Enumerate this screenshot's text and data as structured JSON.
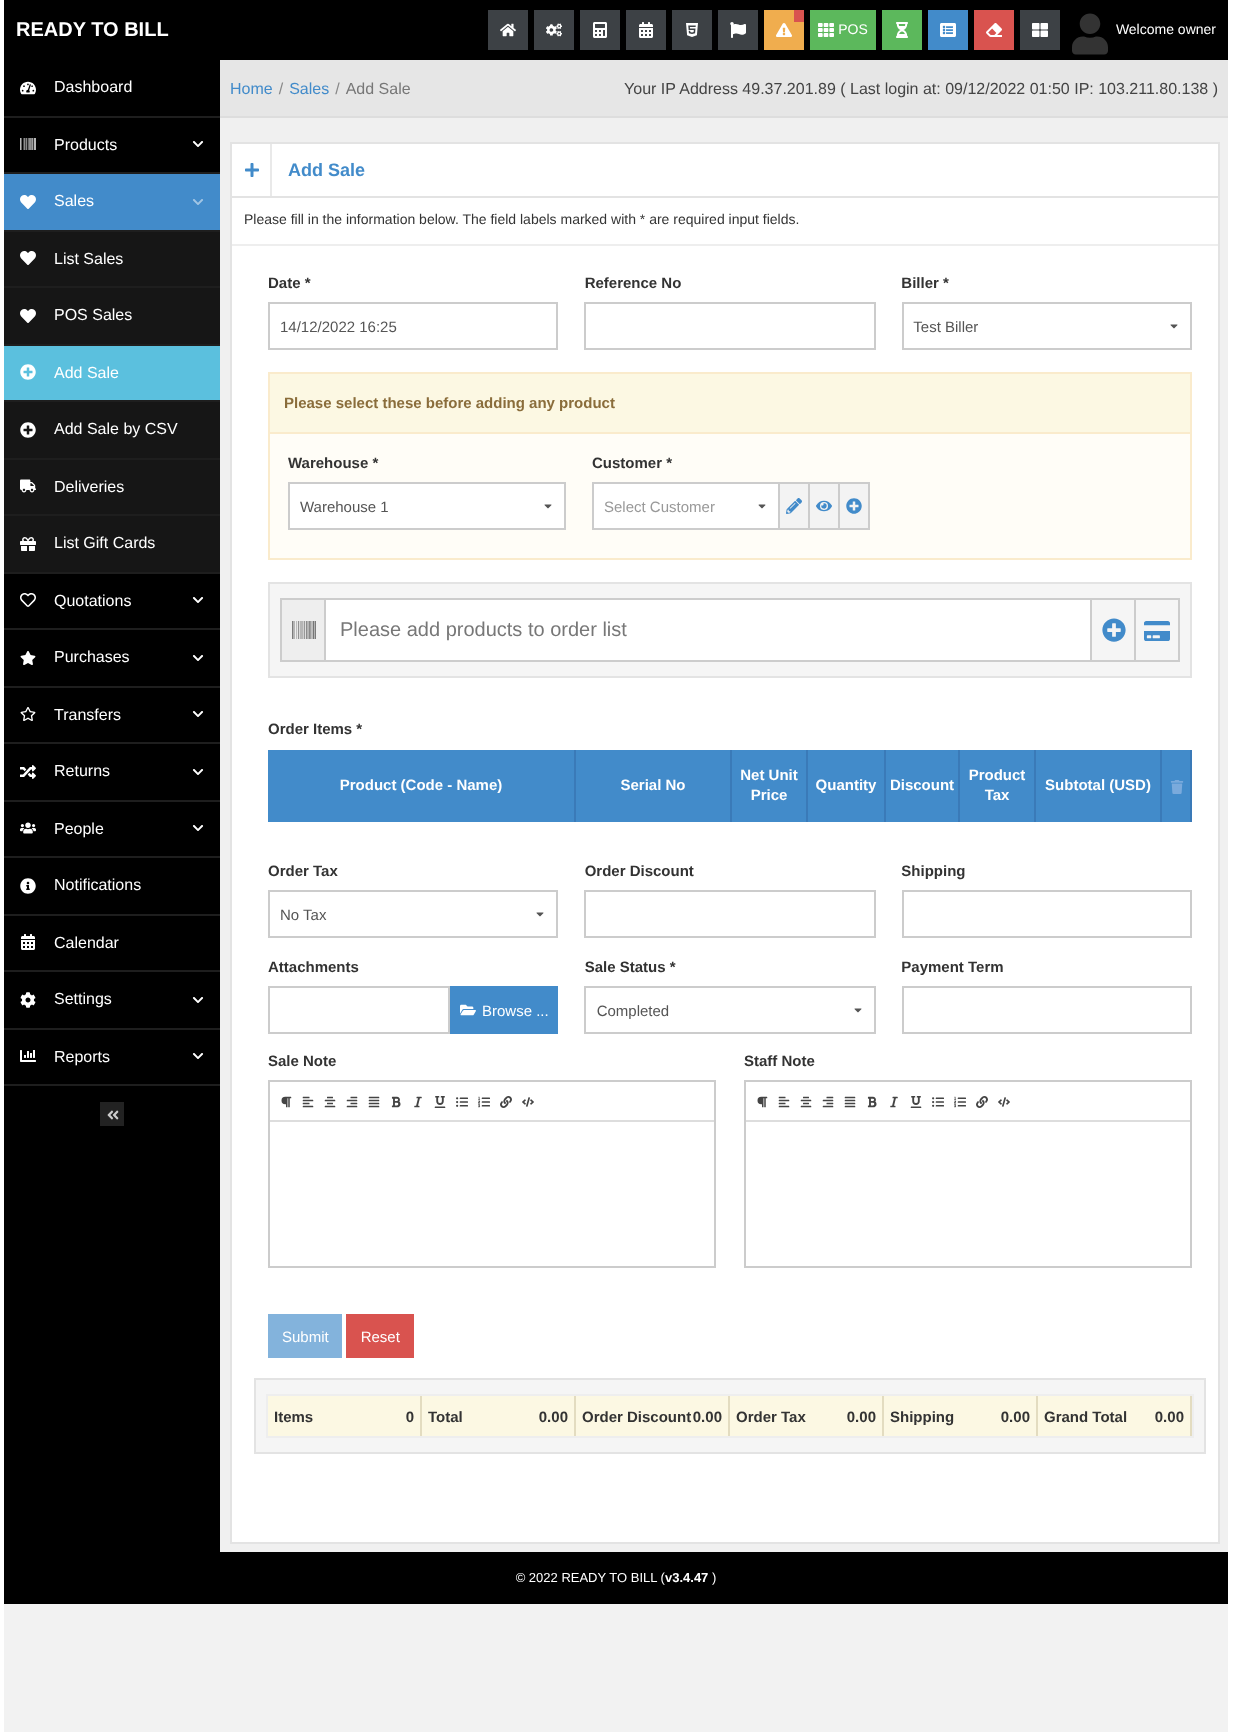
{
  "topbar": {
    "brand": "READY TO BILL",
    "buttons": [
      {
        "kind": "home",
        "color": "#3d4145"
      },
      {
        "kind": "cogs",
        "color": "#3d4145"
      },
      {
        "kind": "calculator",
        "color": "#3d4145"
      },
      {
        "kind": "calendar",
        "color": "#3d4145"
      },
      {
        "kind": "html",
        "color": "#3d4145"
      },
      {
        "kind": "flag",
        "color": "#3d4145"
      },
      {
        "kind": "alert",
        "color": "#f0ad4e",
        "badge": true
      },
      {
        "kind": "pos",
        "color": "#5cb85c",
        "label": "POS"
      },
      {
        "kind": "hourglass",
        "color": "#5cb85c"
      },
      {
        "kind": "list",
        "color": "#428bca"
      },
      {
        "kind": "eraser",
        "color": "#d9534f"
      },
      {
        "kind": "grid",
        "color": "#3d4145"
      }
    ],
    "welcome": "Welcome owner"
  },
  "sidebar": {
    "items": [
      {
        "label": "Dashboard",
        "kind": "dashboard",
        "expandable": false,
        "selected": false
      },
      {
        "label": "Products",
        "kind": "barcode",
        "expandable": true,
        "selected": false
      },
      {
        "label": "Sales",
        "kind": "heart",
        "expandable": true,
        "expanded": true,
        "selected": true,
        "children": [
          {
            "label": "List Sales",
            "kind": "heart",
            "selected": false
          },
          {
            "label": "POS Sales",
            "kind": "heart",
            "selected": false
          },
          {
            "label": "Add Sale",
            "kind": "plus",
            "selected": true
          },
          {
            "label": "Add Sale by CSV",
            "kind": "plus",
            "selected": false
          },
          {
            "label": "Deliveries",
            "kind": "truck",
            "selected": false
          },
          {
            "label": "List Gift Cards",
            "kind": "gift",
            "selected": false
          }
        ]
      },
      {
        "label": "Quotations",
        "kind": "heart-outline",
        "expandable": true,
        "selected": false
      },
      {
        "label": "Purchases",
        "kind": "star",
        "expandable": true,
        "selected": false
      },
      {
        "label": "Transfers",
        "kind": "star-outline",
        "expandable": true,
        "selected": false
      },
      {
        "label": "Returns",
        "kind": "random",
        "expandable": true,
        "selected": false
      },
      {
        "label": "People",
        "kind": "users",
        "expandable": true,
        "selected": false
      },
      {
        "label": "Notifications",
        "kind": "info",
        "expandable": false,
        "selected": false
      },
      {
        "label": "Calendar",
        "kind": "calendar",
        "expandable": false,
        "selected": false
      },
      {
        "label": "Settings",
        "kind": "cog",
        "expandable": true,
        "selected": false
      },
      {
        "label": "Reports",
        "kind": "chart",
        "expandable": true,
        "selected": false
      }
    ]
  },
  "breadcrumb": {
    "separator": "/",
    "items": [
      {
        "label": "Home",
        "kind": "link"
      },
      {
        "label": "Sales",
        "kind": "link"
      },
      {
        "label": "Add Sale",
        "kind": "current"
      }
    ]
  },
  "login_info": "Your IP Address 49.37.201.89 ( Last login at: 09/12/2022 01:50 IP: 103.211.80.138 )",
  "box": {
    "title": "Add Sale",
    "intro": "Please fill in the information below. The field labels marked with * are required input fields."
  },
  "top_fields": [
    {
      "label": "Date *",
      "kind": "input",
      "value": "14/12/2022 16:25"
    },
    {
      "label": "Reference No",
      "kind": "input"
    },
    {
      "label": "Biller *",
      "kind": "select",
      "value": "Test Biller"
    }
  ],
  "notice": {
    "title": "Please select these before adding any product",
    "fields": [
      {
        "label": "Warehouse *",
        "kind": "select",
        "value": "Warehouse 1"
      },
      {
        "label": "Customer *",
        "kind": "select_actions",
        "placeholder": "Select Customer"
      }
    ]
  },
  "product_search": {
    "placeholder": "Please add products to order list"
  },
  "order_items": {
    "label": "Order Items *",
    "columns": [
      "Product (Code - Name)",
      "Serial No",
      "Net Unit Price",
      "Quantity",
      "Discount",
      "Product Tax",
      "Subtotal (USD)"
    ]
  },
  "bottom_fields": [
    {
      "label": "Order Tax",
      "kind": "select",
      "value": "No Tax"
    },
    {
      "label": "Order Discount",
      "kind": "input"
    },
    {
      "label": "Shipping",
      "kind": "input"
    },
    {
      "label": "Attachments",
      "kind": "file",
      "button": "Browse ..."
    },
    {
      "label": "Sale Status *",
      "kind": "select",
      "value": "Completed"
    },
    {
      "label": "Payment Term",
      "kind": "input"
    }
  ],
  "notes": [
    {
      "label": "Sale Note"
    },
    {
      "label": "Staff Note"
    }
  ],
  "actions": [
    {
      "label": "Submit",
      "kind": "primary",
      "disabled": true
    },
    {
      "label": "Reset",
      "kind": "danger",
      "disabled": false
    }
  ],
  "totals": [
    {
      "label": "Items",
      "value": "0"
    },
    {
      "label": "Total",
      "value": "0.00"
    },
    {
      "label": "Order Discount",
      "value": "0.00"
    },
    {
      "label": "Order Tax",
      "value": "0.00"
    },
    {
      "label": "Shipping",
      "value": "0.00"
    },
    {
      "label": "Grand Total",
      "value": "0.00"
    }
  ],
  "footer": {
    "text": "© 2022 READY TO BILL (**v3.4.47** )"
  }
}
